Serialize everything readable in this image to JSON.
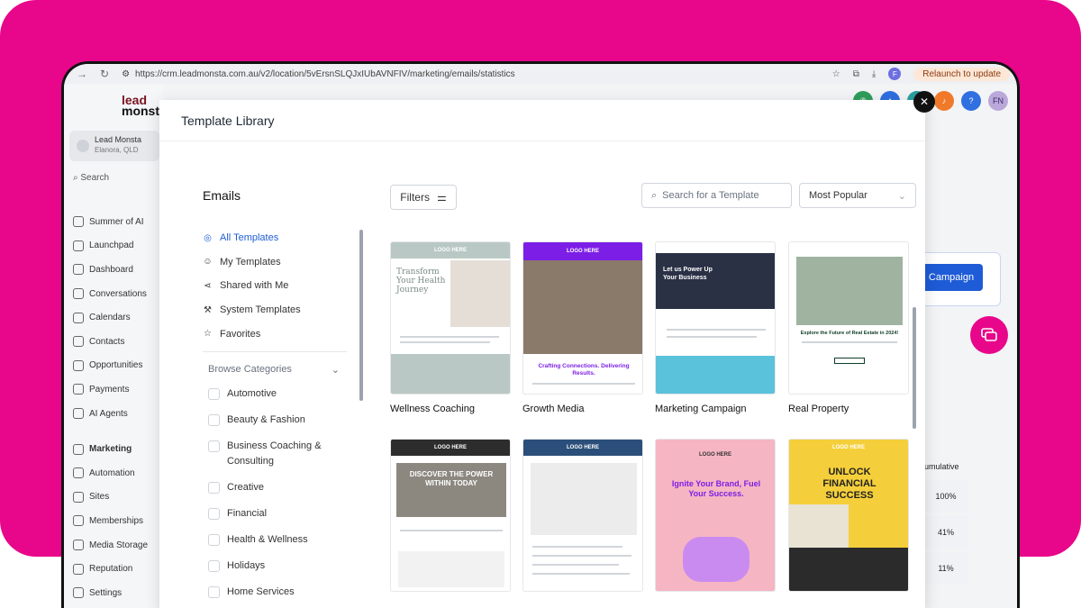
{
  "browser": {
    "url": "https://crm.leadmonsta.com.au/v2/location/5vErsnSLQJxIUbAVNFIV/marketing/emails/statistics",
    "relaunch_label": "Relaunch to update",
    "profile_initial": "F"
  },
  "app": {
    "logo_line1": "lead",
    "logo_line2": "monsta",
    "location_name": "Lead Monsta",
    "location_sub": "Elanora, QLD",
    "search_label": "Search",
    "sidebar_items": [
      {
        "label": "Summer of AI",
        "icon": "sparkle-icon"
      },
      {
        "label": "Launchpad",
        "icon": "rocket-icon"
      },
      {
        "label": "Dashboard",
        "icon": "grid-icon"
      },
      {
        "label": "Conversations",
        "icon": "chat-icon"
      },
      {
        "label": "Calendars",
        "icon": "calendar-icon"
      },
      {
        "label": "Contacts",
        "icon": "contacts-icon"
      },
      {
        "label": "Opportunities",
        "icon": "funnel-icon"
      },
      {
        "label": "Payments",
        "icon": "card-icon"
      },
      {
        "label": "AI Agents",
        "icon": "bot-icon"
      }
    ],
    "sidebar_items_2": [
      {
        "label": "Marketing",
        "icon": "send-icon"
      },
      {
        "label": "Automation",
        "icon": "automation-icon"
      },
      {
        "label": "Sites",
        "icon": "globe-icon"
      },
      {
        "label": "Memberships",
        "icon": "membership-icon"
      },
      {
        "label": "Media Storage",
        "icon": "image-icon"
      },
      {
        "label": "Reputation",
        "icon": "star-icon"
      },
      {
        "label": "Settings",
        "icon": "gear-icon"
      }
    ],
    "user_initials": "FN",
    "help_label": "?",
    "campaign_button": "Campaign",
    "table_header": "umulative",
    "table_values": [
      "100%",
      "41%",
      "11%"
    ]
  },
  "modal": {
    "title": "Template Library",
    "section_title": "Emails",
    "nav": [
      {
        "label": "All Templates",
        "icon": "check-circle-icon",
        "active": true
      },
      {
        "label": "My Templates",
        "icon": "user-icon",
        "active": false
      },
      {
        "label": "Shared with Me",
        "icon": "share-icon",
        "active": false
      },
      {
        "label": "System Templates",
        "icon": "wrench-icon",
        "active": false
      },
      {
        "label": "Favorites",
        "icon": "star-icon",
        "active": false
      }
    ],
    "browse_label": "Browse Categories",
    "categories": [
      "Automotive",
      "Beauty & Fashion",
      "Business Coaching & Consulting",
      "Creative",
      "Financial",
      "Health & Wellness",
      "Holidays",
      "Home Services"
    ],
    "filters_label": "Filters",
    "search_placeholder": "Search for a Template",
    "sort_value": "Most Popular",
    "templates": [
      {
        "name": "Wellness Coaching",
        "header": "LOGO HERE",
        "headline": "Transform Your Health Journey",
        "accent": "#b9c8c4"
      },
      {
        "name": "Growth Media",
        "header": "LOGO HERE",
        "headline": "Crafting Connections. Delivering Results.",
        "accent": "#7c1ee6"
      },
      {
        "name": "Marketing Campaign",
        "header": "LOGO HERE",
        "headline": "Let us Power Up Your Business",
        "accent": "#5bc2dc"
      },
      {
        "name": "Real Property",
        "header": "LOGO HERE",
        "headline": "Explore the Future of Real Estate in 2024!",
        "accent": "#0f3d27"
      },
      {
        "name": "",
        "header": "LOGO HERE",
        "headline": "DISCOVER THE POWER WITHIN TODAY",
        "accent": "#2d2d2d"
      },
      {
        "name": "",
        "header": "LOGO HERE",
        "headline": "",
        "accent": "#2b4f7a"
      },
      {
        "name": "",
        "header": "LOGO HERE",
        "headline": "Ignite Your Brand, Fuel Your Success.",
        "accent": "#f6b5c3"
      },
      {
        "name": "",
        "header": "LOGO HERE",
        "headline": "UNLOCK FINANCIAL SUCCESS",
        "accent": "#f5cf3b"
      }
    ]
  }
}
